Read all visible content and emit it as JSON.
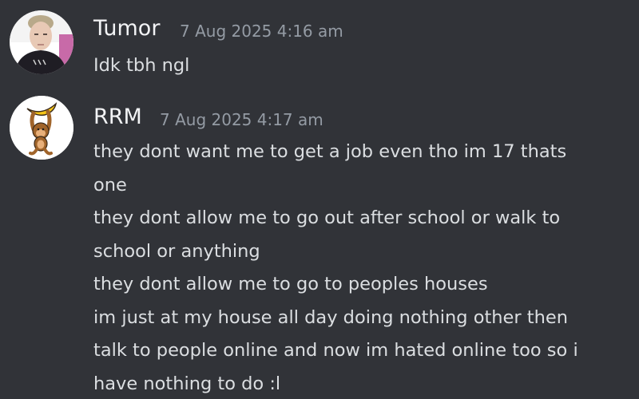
{
  "messages": [
    {
      "username": "Tumor",
      "timestamp": "7 Aug 2025 4:16 am",
      "lines": [
        "Idk tbh ngl"
      ]
    },
    {
      "username": "RRM",
      "timestamp": "7 Aug 2025 4:17 am",
      "lines": [
        "they dont want me to get a job even tho im 17 thats",
        "one",
        "they dont allow me to go out after school or walk to",
        "school or anything",
        "they dont allow me to go to peoples houses",
        "im just at my house all day doing nothing other then",
        "talk to people online and now im hated online too so i",
        "have nothing to do :l"
      ]
    }
  ],
  "colors": {
    "background": "#313338",
    "username": "#f2f3f5",
    "timestamp": "#949ba4",
    "text": "#dbdee1"
  }
}
